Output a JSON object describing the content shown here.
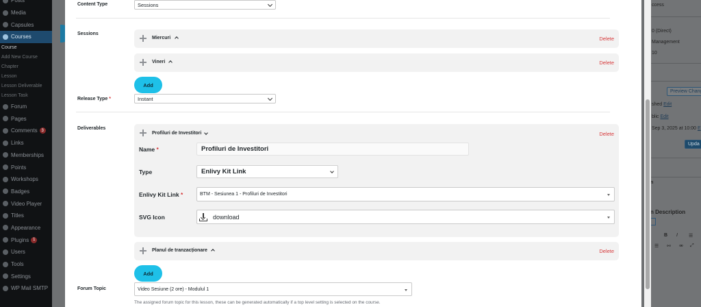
{
  "sidebar": {
    "items_top": [
      {
        "label": "Posts"
      },
      {
        "label": "Media"
      },
      {
        "label": "Capsules"
      }
    ],
    "active": {
      "label": "Courses"
    },
    "subitems": [
      {
        "label": "Course",
        "current": true
      },
      {
        "label": "Add New Course"
      },
      {
        "label": "Chapter"
      },
      {
        "label": "Lesson"
      },
      {
        "label": "Lesson Deliverable"
      },
      {
        "label": "Lesson Task"
      }
    ],
    "items_bottom": [
      {
        "label": "Forum"
      },
      {
        "label": "Pages"
      },
      {
        "label": "Comments",
        "badge": "3"
      },
      {
        "label": "Links"
      },
      {
        "label": "Memberships"
      },
      {
        "label": "Points"
      },
      {
        "label": "Workshops"
      },
      {
        "label": "Badges"
      },
      {
        "label": "Video Player"
      },
      {
        "label": "Titles"
      },
      {
        "label": "Appearance"
      },
      {
        "label": "Plugins",
        "badge": "1"
      },
      {
        "label": "Users"
      },
      {
        "label": "Tools"
      },
      {
        "label": "Settings"
      },
      {
        "label": "WP Mail SMTP"
      }
    ]
  },
  "right_panel": {
    "access": "ccess",
    "direct": "0 (Direct)",
    "management": "Management",
    "num": "10",
    "preview_btn": "Preview Chang",
    "shed": "shed",
    "edit1": "Edit",
    "blic": "blic",
    "edit2": "Edit",
    "date": "Sep 3, 2025 at 10:00",
    "date_link": "E",
    "update_btn": "Upda",
    "n": "n",
    "description": "n Description"
  },
  "form": {
    "content_type": {
      "label": "Content Type",
      "value": "Sessions"
    },
    "sessions": {
      "label": "Sessions",
      "items": [
        {
          "title": "Miercuri"
        },
        {
          "title": "Vineri"
        }
      ],
      "add_label": "Add"
    },
    "release_type": {
      "label": "Release Type",
      "value": "Instant"
    },
    "deliverables": {
      "label": "Deliverables",
      "expanded": {
        "title": "Profiluri de Investitori",
        "name_label": "Name",
        "name_value": "Profiluri de Investitori",
        "type_label": "Type",
        "type_value": "Enlivy Kit Link",
        "kit_label": "Enlivy Kit Link",
        "kit_value": "BTM - Sesiunea 1 - Profiluri de Investitori",
        "svg_label": "SVG Icon",
        "svg_value": "download"
      },
      "collapsed": {
        "title": "Planul de tranzacționare"
      },
      "add_label": "Add"
    },
    "forum_topic": {
      "label": "Forum Topic",
      "value": "Video Sesiune (2 ore) - Modulul 1",
      "help": "The assigned forum topic for this lesson, these can be generated automatically if a top level setting is selected on the course."
    },
    "delete_label": "Delete",
    "required_mark": "*"
  },
  "colors": {
    "accent": "#1ec0e8",
    "danger": "#d63638",
    "card": "#f2f2f2"
  }
}
